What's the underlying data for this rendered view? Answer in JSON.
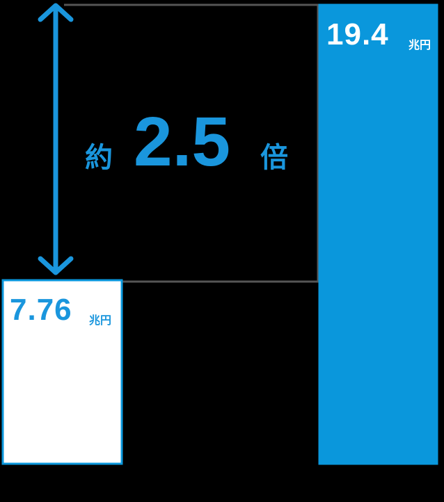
{
  "chart_data": {
    "type": "bar",
    "categories": [
      "",
      ""
    ],
    "values": [
      7.76,
      19.4
    ],
    "unit": "兆円",
    "value_labels": [
      "7.76",
      "19.4"
    ],
    "ylim": [
      0,
      19.4
    ],
    "grid": false,
    "bar_colors": [
      "#ffffff",
      "#0a97dc"
    ],
    "bar_borders": [
      "#0a97dc",
      "#0a97dc"
    ],
    "annotation": {
      "prefix": "約",
      "value": "2.5",
      "suffix": "倍"
    }
  },
  "colors": {
    "accent": "#1a96dd",
    "background": "#000000",
    "guide_line": "#555555"
  },
  "icons": [
    "double-arrow-icon"
  ]
}
